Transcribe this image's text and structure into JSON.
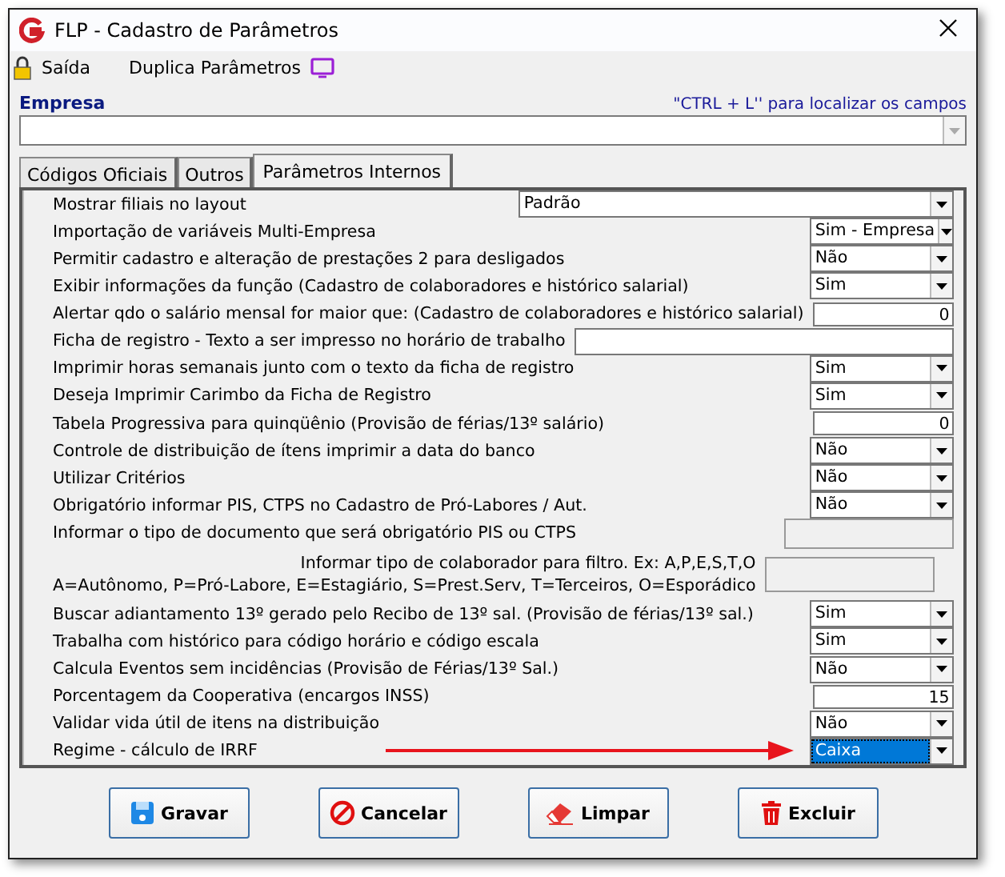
{
  "window": {
    "title": "FLP - Cadastro de Parâmetros"
  },
  "toolbar": [
    {
      "kind": "lock",
      "label": "Saída"
    },
    {
      "kind": "monitor",
      "label": "Duplica Parâmetros"
    }
  ],
  "empresa": {
    "label": "Empresa",
    "hint": "\"CTRL + L'' para localizar os campos"
  },
  "tabs": [
    {
      "label": "Códigos Oficiais",
      "selected": false
    },
    {
      "label": "Outros",
      "selected": false
    },
    {
      "label": "Parâmetros Internos",
      "selected": true
    }
  ],
  "rows": [
    {
      "label": "Mostrar filiais no layout",
      "kind": "select_wide",
      "value": "Padrão",
      "highlighted": false
    },
    {
      "label": "Importação de variáveis Multi-Empresa",
      "kind": "select",
      "value": "Sim - Empresa",
      "highlighted": false
    },
    {
      "label": "Permitir cadastro e alteração de prestações 2 para desligados",
      "kind": "select",
      "value": "Não",
      "highlighted": false
    },
    {
      "label": "Exibir informações da função (Cadastro de colaboradores e histórico salarial)",
      "kind": "select",
      "value": "Sim",
      "highlighted": false
    },
    {
      "label": "Alertar qdo o salário mensal for maior que: (Cadastro de colaboradores e histórico salarial)",
      "kind": "number",
      "value": "0"
    },
    {
      "label": "Ficha de registro - Texto a ser impresso no horário de trabalho",
      "kind": "text"
    },
    {
      "label": "Imprimir horas semanais junto com o texto da ficha de registro",
      "kind": "select",
      "value": "Sim",
      "highlighted": false
    },
    {
      "label": "Deseja Imprimir Carimbo da Ficha de Registro",
      "kind": "select",
      "value": "Sim",
      "highlighted": false
    },
    {
      "label": "Tabela Progressiva para quinqüênio (Provisão de férias/13º salário)",
      "kind": "number",
      "value": "0"
    },
    {
      "label": "Controle de distribuição de ítens imprimir a data do banco",
      "kind": "select",
      "value": "Não",
      "highlighted": false
    },
    {
      "label": "Utilizar Critérios",
      "kind": "select",
      "value": "Não",
      "highlighted": false
    },
    {
      "label": "Obrigatório informar PIS, CTPS no Cadastro de  Pró-Labores / Aut.",
      "kind": "select",
      "value": "Não",
      "highlighted": false
    },
    {
      "label": "Informar o tipo de documento que será obrigatório PIS ou CTPS",
      "kind": "disabled"
    },
    {
      "label_lines": [
        "Informar tipo de colaborador para filtro. Ex: A,P,E,S,T,O",
        "A=Autônomo, P=Pró-Labore, E=Estagiário, S=Prest.Serv, T=Terceiros, O=Esporádico"
      ],
      "kind": "disabled_two_line"
    },
    {
      "label": "Buscar adiantamento 13º  gerado pelo Recibo de 13º sal. (Provisão de férias/13º sal.)",
      "kind": "select",
      "value": "Sim",
      "highlighted": false
    },
    {
      "label": "Trabalha com histórico para código horário e código escala",
      "kind": "select",
      "value": "Sim",
      "highlighted": false
    },
    {
      "label": "Calcula Eventos sem incidências (Provisão de Férias/13º Sal.)",
      "kind": "select",
      "value": "Não",
      "highlighted": false
    },
    {
      "label": "Porcentagem da Cooperativa (encargos INSS)",
      "kind": "number",
      "value": "15"
    },
    {
      "label": "Validar vida útil de itens na distribuição",
      "kind": "select",
      "value": "Não",
      "highlighted": false
    },
    {
      "label": "Regime - cálculo de IRRF",
      "kind": "select",
      "value": "Caixa",
      "highlighted": true,
      "annotated": true
    }
  ],
  "buttons": [
    {
      "kind": "save",
      "label": "Gravar"
    },
    {
      "kind": "cancel",
      "label": "Cancelar"
    },
    {
      "kind": "clear",
      "label": "Limpar"
    },
    {
      "kind": "delete",
      "label": "Excluir"
    }
  ]
}
